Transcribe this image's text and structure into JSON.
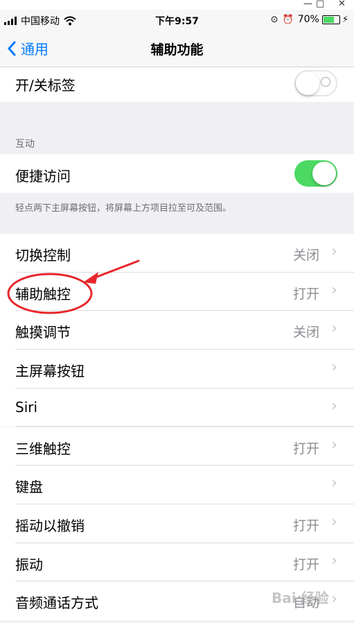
{
  "window": {
    "minimize": "—",
    "maximize": "□",
    "close": "✕"
  },
  "status_bar": {
    "carrier": "中国移动",
    "time": "下午9:57",
    "battery": "70%",
    "battery_level": 0.7
  },
  "nav": {
    "back_label": "通用",
    "title": "辅助功能"
  },
  "rows_top": [
    {
      "label": "开/关标签",
      "toggle_on": false
    }
  ],
  "interaction": {
    "header": "互动",
    "reachability": {
      "label": "便捷访问",
      "toggle_on": true
    },
    "footnote": "轻点两下主屏幕按钮，将屏幕上方项目拉至可及范围。"
  },
  "settings": [
    {
      "label": "切换控制",
      "value": "关闭"
    },
    {
      "label": "辅助触控",
      "value": "打开"
    },
    {
      "label": "触摸调节",
      "value": "关闭"
    },
    {
      "label": "主屏幕按钮",
      "value": ""
    },
    {
      "label": "Siri",
      "value": ""
    },
    {
      "label": "三维触控",
      "value": "打开"
    },
    {
      "label": "键盘",
      "value": ""
    },
    {
      "label": "摇动以撤销",
      "value": "打开"
    },
    {
      "label": "振动",
      "value": "打开"
    },
    {
      "label": "音频通话方式",
      "value": "自动"
    }
  ],
  "colors": {
    "accent": "#007aff",
    "toggle_on": "#4cd964",
    "annotation": "#e8262b"
  },
  "watermark": "Bai 经验"
}
